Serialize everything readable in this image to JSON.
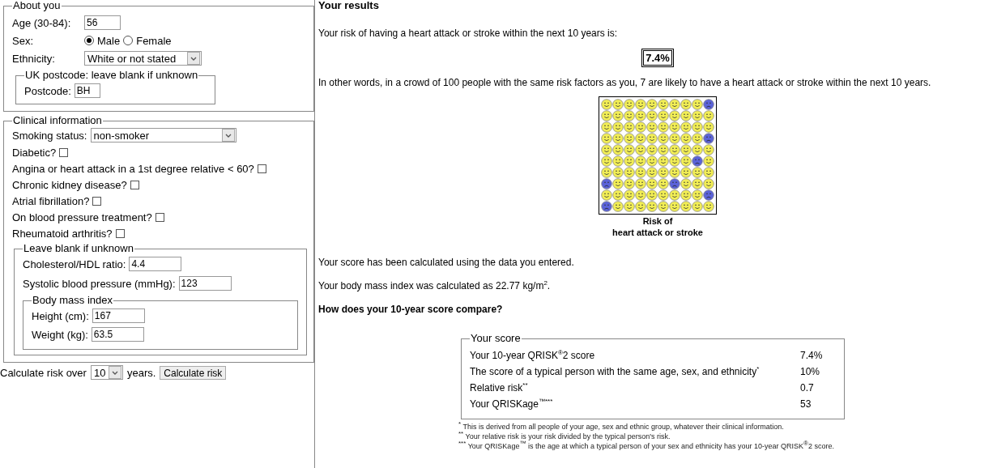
{
  "about": {
    "legend": "About you",
    "age": {
      "label": "Age (30-84):",
      "value": "56"
    },
    "sex": {
      "label": "Sex:",
      "options": [
        {
          "label": "Male",
          "selected": true
        },
        {
          "label": "Female",
          "selected": false
        }
      ]
    },
    "ethnicity": {
      "label": "Ethnicity:",
      "value": "White or not stated"
    },
    "postcode": {
      "legend": "UK postcode: leave blank if unknown",
      "label": "Postcode:",
      "value": "BH"
    }
  },
  "clinical": {
    "legend": "Clinical information",
    "smoking": {
      "label": "Smoking status:",
      "value": "non-smoker"
    },
    "conditions": [
      {
        "label": "Diabetic?",
        "checked": false
      },
      {
        "label": "Angina or heart attack in a 1st degree relative < 60?",
        "checked": false
      },
      {
        "label": "Chronic kidney disease?",
        "checked": false
      },
      {
        "label": "Atrial fibrillation?",
        "checked": false
      },
      {
        "label": "On blood pressure treatment?",
        "checked": false
      },
      {
        "label": "Rheumatoid arthritis?",
        "checked": false
      }
    ],
    "optional": {
      "legend": "Leave blank if unknown",
      "fields": [
        {
          "label": "Cholesterol/HDL ratio:",
          "value": "4.4"
        },
        {
          "label": "Systolic blood pressure (mmHg):",
          "value": "123"
        }
      ],
      "bmi": {
        "legend": "Body mass index",
        "fields": [
          {
            "label": "Height (cm):",
            "value": "167"
          },
          {
            "label": "Weight (kg):",
            "value": "63.5"
          }
        ]
      }
    }
  },
  "calculate": {
    "label_before": "Calculate risk over",
    "years": "10",
    "label_after": "years.",
    "button": "Calculate risk"
  },
  "results": {
    "title": "Your results",
    "intro": "Your risk of having a heart attack or stroke within the next 10 years is:",
    "risk": "7.4%",
    "crowd_text": "In other words, in a crowd of 100 people with the same risk factors as you, 7 are likely to have a heart attack or stroke within the next 10 years.",
    "crowd": {
      "caption": [
        "Risk of",
        "heart attack or stroke"
      ],
      "rows": [
        [
          false,
          false,
          false,
          false,
          false,
          false,
          false,
          false,
          false,
          true
        ],
        [
          false,
          false,
          false,
          false,
          false,
          false,
          false,
          false,
          false,
          false
        ],
        [
          false,
          false,
          false,
          false,
          false,
          false,
          false,
          false,
          false,
          false
        ],
        [
          false,
          false,
          false,
          false,
          false,
          false,
          false,
          false,
          false,
          true
        ],
        [
          false,
          false,
          false,
          false,
          false,
          false,
          false,
          false,
          false,
          false
        ],
        [
          false,
          false,
          false,
          false,
          false,
          false,
          false,
          false,
          true,
          false
        ],
        [
          false,
          false,
          false,
          false,
          false,
          false,
          false,
          false,
          false,
          false
        ],
        [
          true,
          false,
          false,
          false,
          false,
          false,
          true,
          false,
          false,
          false
        ],
        [
          false,
          false,
          false,
          false,
          false,
          false,
          false,
          false,
          false,
          true
        ],
        [
          true,
          false,
          false,
          false,
          false,
          false,
          false,
          false,
          false,
          false
        ]
      ]
    },
    "notes": [
      "Your score has been calculated using the data you entered.",
      "Your body mass index was calculated as 22.77 kg/m$^{2}$."
    ],
    "compare_heading": "How does your 10-year score compare?",
    "score": {
      "legend": "Your score",
      "rows": [
        {
          "label": "Your 10-year QRISK$^{®}$2 score",
          "value": "7.4%"
        },
        {
          "label": "The score of a typical person with the same age, sex, and ethnicity$^{*}$",
          "value": "10%"
        },
        {
          "label": "Relative risk$^{**}$",
          "value": "0.7"
        },
        {
          "label": "Your QRISKage$^{™***}$",
          "value": "53"
        }
      ]
    },
    "footnotes": [
      "$^{*}$ This is derived from all people of your age, sex and ethnic group, whatever their clinical information.",
      "$^{**}$ Your relative risk is your risk divided by the typical person's risk.",
      "$^{***}$ Your QRISKage$^{™}$ is the age at which a typical person of your sex and ethnicity has your 10-year QRISK$^{®}$2 score."
    ]
  }
}
